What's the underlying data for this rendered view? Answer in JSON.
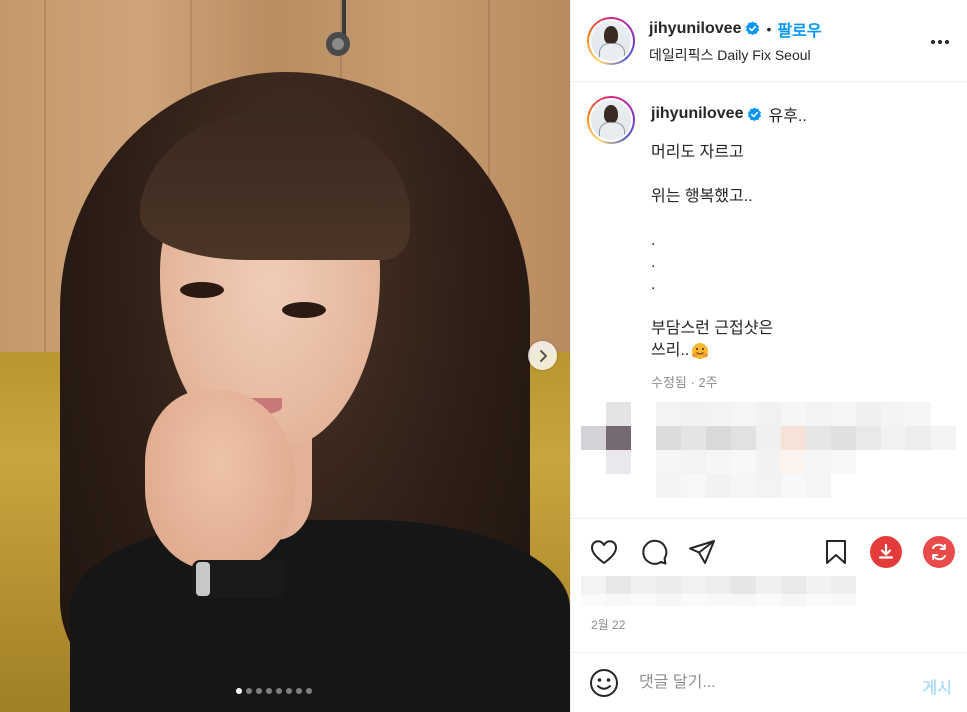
{
  "colors": {
    "brand_blue": "#0095f6",
    "text_primary": "#262626",
    "text_secondary": "#8e8e8e",
    "divider": "#efefef",
    "download_red": "#e53a3a",
    "refresh_red": "#e94a4a",
    "post_disabled": "#b2dffc"
  },
  "header": {
    "username": "jihyunilovee",
    "separator": "•",
    "follow_label": "팔로우",
    "location": "데일리픽스 Daily Fix Seoul",
    "more_icon": "more-horizontal-icon"
  },
  "caption": {
    "username": "jihyunilovee",
    "first_line": "유후..",
    "lines": [
      "머리도 자르고",
      "",
      "위는 행복했고..",
      "",
      ".",
      ".",
      ".",
      "",
      "부담스런 근접샷은",
      "쓰리.."
    ],
    "emoji_icon": "hugging-face-icon",
    "meta": "수정됨 · 2주"
  },
  "actions": {
    "like_icon": "heart-icon",
    "comment_icon": "comment-icon",
    "share_icon": "share-icon",
    "save_icon": "bookmark-icon",
    "download_icon": "download-icon",
    "refresh_icon": "refresh-icon"
  },
  "post": {
    "date": "2월 22"
  },
  "comment": {
    "emoji_icon": "emoji-icon",
    "placeholder": "댓글 달기...",
    "post_label": "게시"
  },
  "media": {
    "next_icon": "chevron-right-icon",
    "slide_count": 8,
    "active_slide": 1
  }
}
